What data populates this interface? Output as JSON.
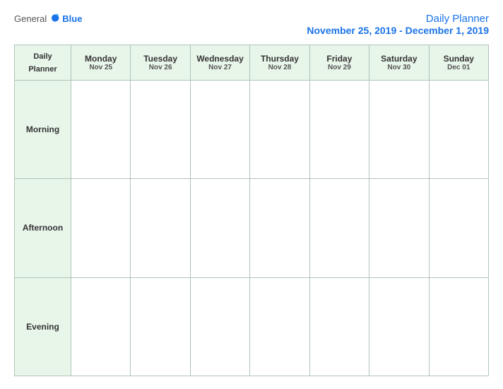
{
  "logo": {
    "general": "General",
    "blue": "Blue"
  },
  "title": {
    "main": "Daily Planner",
    "date_range": "November 25, 2019 - December 1, 2019"
  },
  "table": {
    "corner_label_line1": "Daily",
    "corner_label_line2": "Planner",
    "days": [
      {
        "name": "Monday",
        "date": "Nov 25"
      },
      {
        "name": "Tuesday",
        "date": "Nov 26"
      },
      {
        "name": "Wednesday",
        "date": "Nov 27"
      },
      {
        "name": "Thursday",
        "date": "Nov 28"
      },
      {
        "name": "Friday",
        "date": "Nov 29"
      },
      {
        "name": "Saturday",
        "date": "Nov 30"
      },
      {
        "name": "Sunday",
        "date": "Dec 01"
      }
    ],
    "rows": [
      {
        "label": "Morning"
      },
      {
        "label": "Afternoon"
      },
      {
        "label": "Evening"
      }
    ]
  }
}
